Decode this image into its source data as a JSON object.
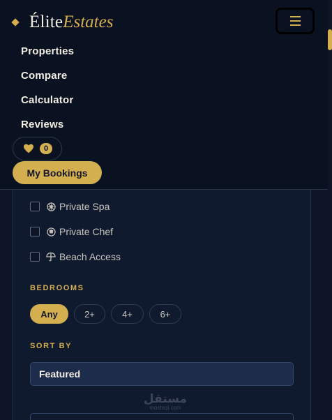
{
  "brand": {
    "name_regular": "Élite",
    "name_italic": "Estates"
  },
  "nav": {
    "menu_links": [
      "Properties",
      "Compare",
      "Calculator",
      "Reviews"
    ],
    "favorites_count": "0",
    "bookings_label": "My Bookings"
  },
  "filters": {
    "amenities": [
      {
        "label": "Private Spa",
        "checked": false,
        "icon": "spa-wheel-icon"
      },
      {
        "label": "Private Chef",
        "checked": false,
        "icon": "chef-icon"
      },
      {
        "label": "Beach Access",
        "checked": false,
        "icon": "umbrella-icon"
      }
    ],
    "bedrooms_label": "BEDROOMS",
    "bedroom_options": [
      "Any",
      "2+",
      "4+",
      "6+"
    ],
    "bedroom_selected": "Any",
    "sort_label": "SORT BY",
    "sort_value": "Featured"
  },
  "watermark": {
    "arabic": "مستقل",
    "latin": "mostaql.com"
  },
  "colors": {
    "accent": "#d4af4f",
    "background": "#0d1526",
    "panel": "#101a2e"
  }
}
